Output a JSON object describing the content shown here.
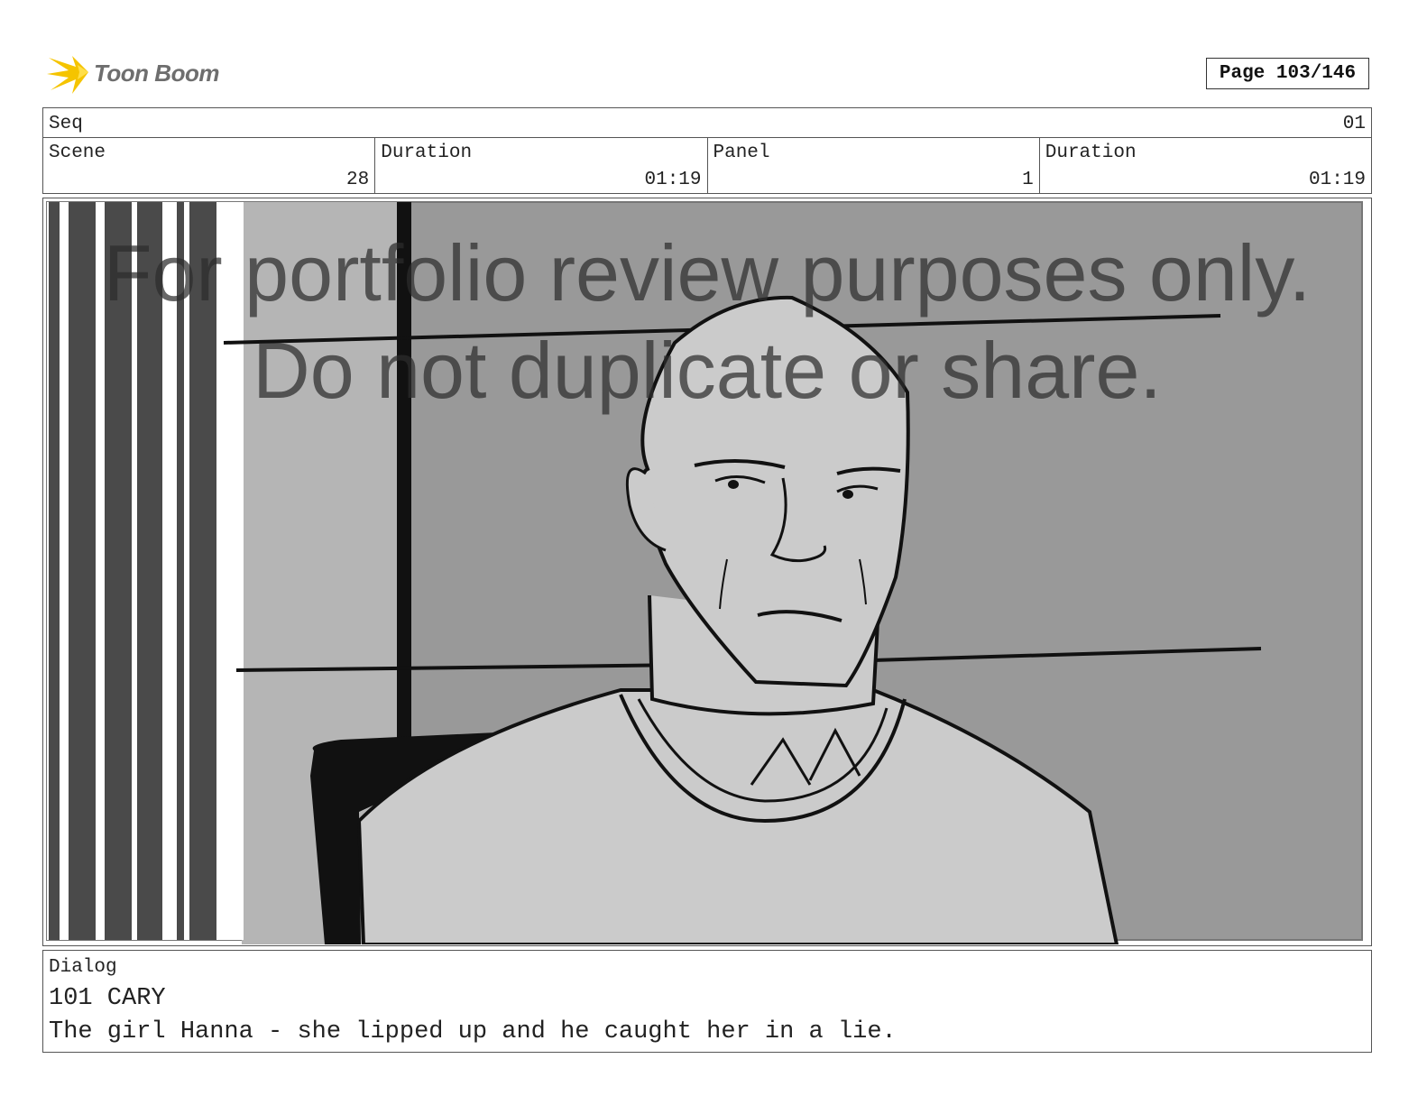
{
  "header": {
    "logo_text": "Toon Boom",
    "page_label": "Page 103/146"
  },
  "sequence": {
    "label": "Seq",
    "value": "01"
  },
  "cells": [
    {
      "label": "Scene",
      "value": "28"
    },
    {
      "label": "Duration",
      "value": "01:19"
    },
    {
      "label": "Panel",
      "value": "1"
    },
    {
      "label": "Duration",
      "value": "01:19"
    }
  ],
  "watermark": {
    "line1": "For portfolio review purposes only.",
    "line2": "Do not duplicate or share."
  },
  "dialog": {
    "label": "Dialog",
    "line1": "101 CARY",
    "line2": "The girl Hanna - she lipped up and he caught her in a lie."
  },
  "colors": {
    "logo_star": "#f5c400",
    "panel_background": "#999999",
    "panel_left_light": "#b5b5b5",
    "figure_fill": "#cbcbcb"
  }
}
